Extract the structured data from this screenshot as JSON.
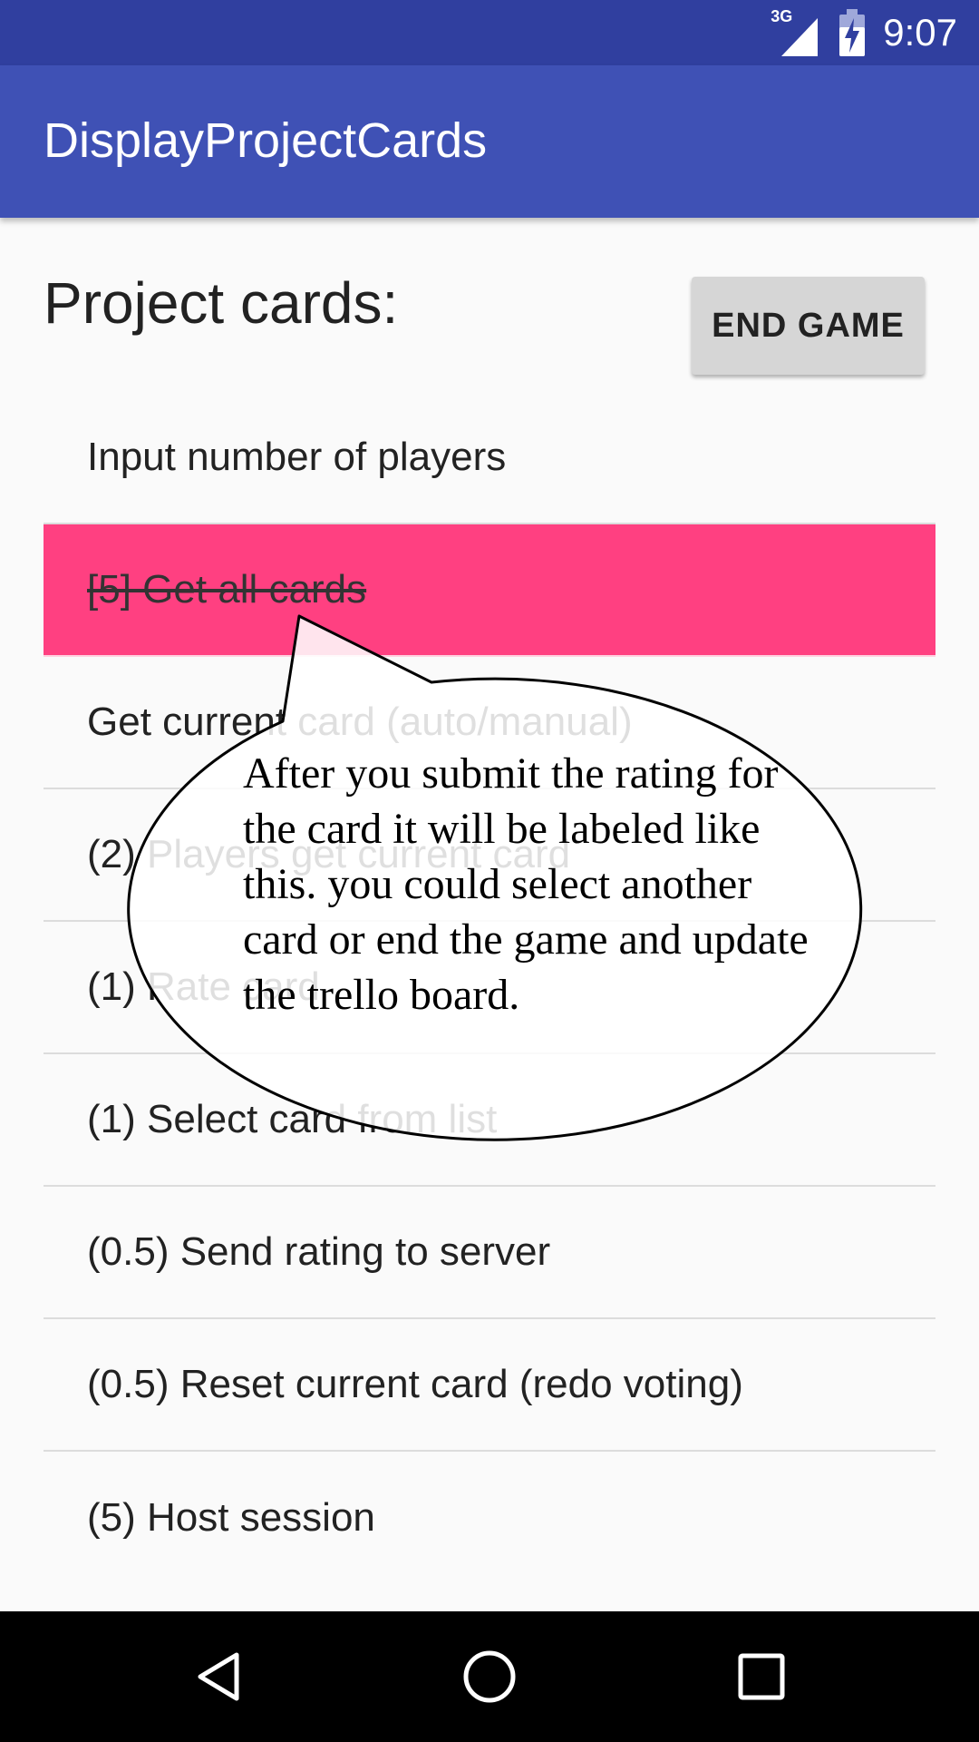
{
  "status_bar": {
    "network_type": "3G",
    "time": "9:07"
  },
  "app_bar": {
    "title": "DisplayProjectCards"
  },
  "main": {
    "heading": "Project cards:",
    "end_game_label": "END GAME",
    "cards": [
      {
        "label": "Input number of players"
      },
      {
        "label": "[5] Get all cards",
        "state": "rated"
      },
      {
        "label": "Get current card (auto/manual)"
      },
      {
        "label": "(2) Players get current card"
      },
      {
        "label": "(1) Rate card"
      },
      {
        "label": "(1) Select card from list"
      },
      {
        "label": "(0.5) Send rating to server"
      },
      {
        "label": "(0.5) Reset current card (redo voting)"
      },
      {
        "label": "(5) Host session"
      }
    ]
  },
  "annotation": {
    "text": "After you submit the rating for the card it will be labeled like this. you could select another card or end the game and update the trello board."
  },
  "nav_bar": {
    "icons": [
      "back-icon",
      "home-icon",
      "recents-icon"
    ]
  },
  "colors": {
    "status_bar": "#303f9f",
    "app_bar": "#3f51b5",
    "selected_card": "#ff4081"
  }
}
